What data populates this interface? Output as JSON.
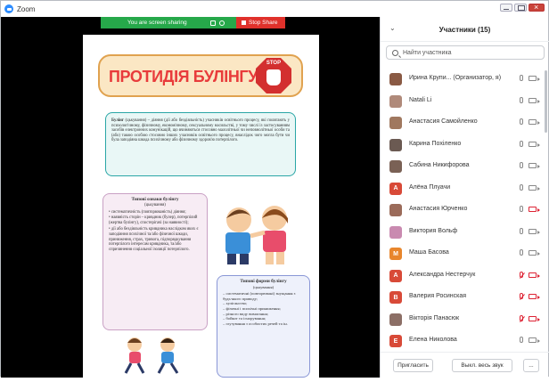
{
  "window": {
    "title": "Zoom"
  },
  "share_bar": {
    "status": "You are screen sharing",
    "stop_label": "Stop Share"
  },
  "poster": {
    "title": "ПРОТИДІЯ БУЛІНГУ",
    "stop_sign_text": "STOP",
    "definition_term": "Булінг",
    "definition": "(цькування) – діяння (дії або бездіяльність) учасників освітнього процесу, які полягають у психологічному, фізичному, економічному, сексуальному насильстві, у тому числі із застосуванням засобів електронних комунікацій, що вчиняються стосовно малолітньої чи неповнолітньої особи та (або) такою особою стосовно інших учасників освітнього процесу, внаслідок чого могла бути чи була заподіяна шкода психічному або фізичному здоров'ю потерпілого.",
    "signs": {
      "heading": "Типові ознаки булінгу",
      "sub": "(цькування)",
      "items": [
        "систематичність (повторюваність) діяння;",
        "наявність сторін – кривдник (булер), потерпілий (жертва булінгу), спостерігачі (за наявності);",
        "дії або бездіяльність кривдника наслідком яких є заподіяння психічної та/або фізичної шкоди, приниження, страх, тривога, підпорядкування потерпілого інтересам кривдника, та/або спричинення соціальної ізоляції потерпілого."
      ]
    },
    "forms": {
      "heading": "Типові форми булінгу",
      "sub": "(цькування)",
      "items": [
        "систематичні (повторювані) знущання з будь-якого приводу;",
        "хуліганство;",
        "фізичні і психічні приниження;",
        "різного виду вимагання;",
        "бойкот та ігнорування;",
        "глузування з особистих речей та ін."
      ]
    }
  },
  "participants": {
    "title": "Участники (15)",
    "search_placeholder": "Найти участника",
    "list": [
      {
        "name": "Ирина Крупи... (Организатор, я)",
        "initial": "",
        "color": "#8a5a44",
        "mic_off": false,
        "cam_off": false
      },
      {
        "name": "Natali Li",
        "initial": "",
        "color": "#b08a7a",
        "mic_off": false,
        "cam_off": false
      },
      {
        "name": "Анастасия Самойленко",
        "initial": "",
        "color": "#a0785f",
        "mic_off": false,
        "cam_off": false
      },
      {
        "name": "Карина Похіленко",
        "initial": "",
        "color": "#6b5a52",
        "mic_off": false,
        "cam_off": false
      },
      {
        "name": "Сабина Никифорова",
        "initial": "",
        "color": "#7a6155",
        "mic_off": false,
        "cam_off": false
      },
      {
        "name": "Алёна Плуачи",
        "initial": "A",
        "color": "#d84a38",
        "mic_off": false,
        "cam_off": false
      },
      {
        "name": "Анастасия Юрченко",
        "initial": "",
        "color": "#9b6b5a",
        "mic_off": false,
        "cam_off": true
      },
      {
        "name": "Виктория Вольф",
        "initial": "",
        "color": "#c98ab0",
        "mic_off": false,
        "cam_off": false
      },
      {
        "name": "Маша Басова",
        "initial": "M",
        "color": "#e8862c",
        "mic_off": false,
        "cam_off": false
      },
      {
        "name": "Александра Нестерчук",
        "initial": "A",
        "color": "#d84a38",
        "mic_off": true,
        "cam_off": true
      },
      {
        "name": "Валерия Росинская",
        "initial": "B",
        "color": "#d84a38",
        "mic_off": true,
        "cam_off": true
      },
      {
        "name": "Вікторія Панасюк",
        "initial": "",
        "color": "#8c6f66",
        "mic_off": true,
        "cam_off": true
      },
      {
        "name": "Елена Николова",
        "initial": "E",
        "color": "#d84a38",
        "mic_off": false,
        "cam_off": false
      }
    ],
    "invite_label": "Пригласить",
    "mute_all_label": "Выкл. весь звук",
    "more_label": "..."
  }
}
